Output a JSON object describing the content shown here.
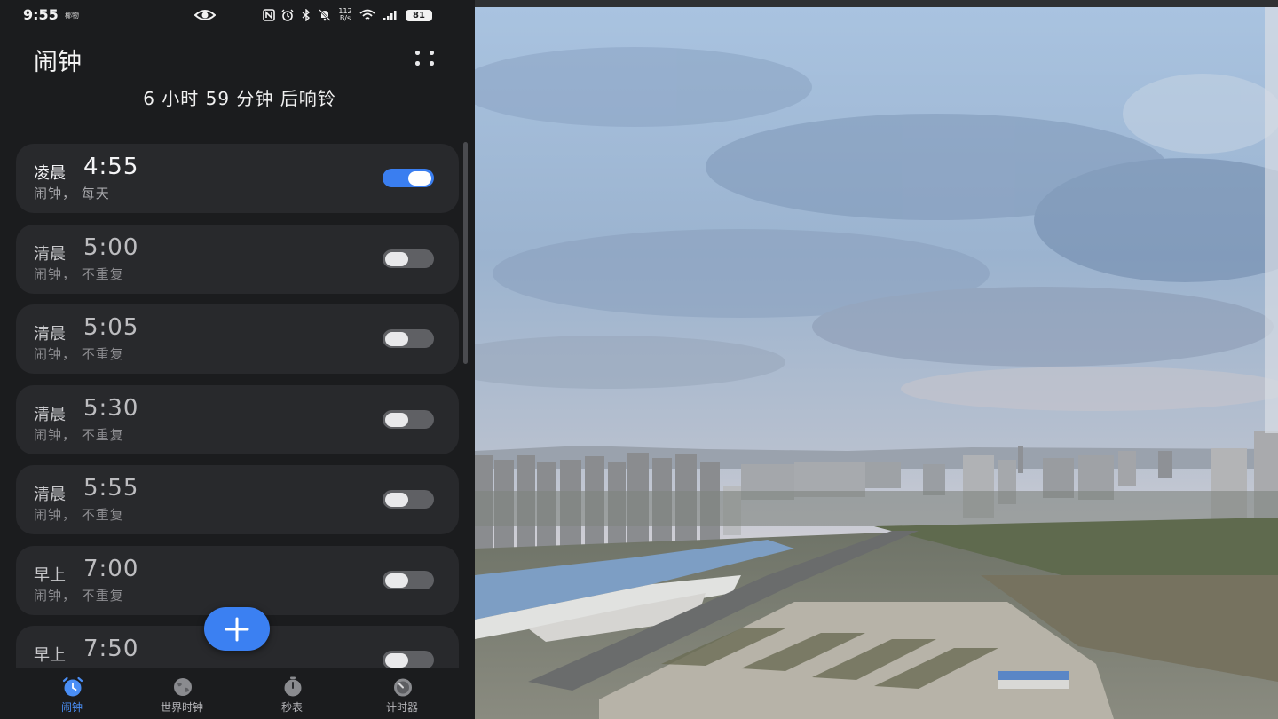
{
  "status_bar": {
    "time": "9:55",
    "carrier_tag": "椰物",
    "net_speed_value": "112",
    "net_speed_unit": "B/s",
    "battery": "81"
  },
  "app": {
    "title": "闹钟",
    "next_ring": "6 小时 59 分钟 后响铃"
  },
  "alarms": [
    {
      "period": "凌晨",
      "time": "4:55",
      "subtitle": "闹钟， 每天",
      "enabled": true
    },
    {
      "period": "清晨",
      "time": "5:00",
      "subtitle": "闹钟， 不重复",
      "enabled": false
    },
    {
      "period": "清晨",
      "time": "5:05",
      "subtitle": "闹钟， 不重复",
      "enabled": false
    },
    {
      "period": "清晨",
      "time": "5:30",
      "subtitle": "闹钟， 不重复",
      "enabled": false
    },
    {
      "period": "清晨",
      "time": "5:55",
      "subtitle": "闹钟， 不重复",
      "enabled": false
    },
    {
      "period": "早上",
      "time": "7:00",
      "subtitle": "闹钟， 不重复",
      "enabled": false
    },
    {
      "period": "早上",
      "time": "7:50",
      "subtitle": "",
      "enabled": false
    }
  ],
  "bottom_nav": {
    "items": [
      {
        "label": "闹钟",
        "icon": "alarm-clock-icon",
        "active": true
      },
      {
        "label": "世界时钟",
        "icon": "globe-icon",
        "active": false
      },
      {
        "label": "秒表",
        "icon": "stopwatch-icon",
        "active": false
      },
      {
        "label": "计时器",
        "icon": "timer-icon",
        "active": false
      }
    ]
  },
  "colors": {
    "accent": "#3b80f2",
    "background": "#1b1c1e",
    "card": "#28292c"
  },
  "photo": {
    "subject": "city-skyline-photo"
  }
}
